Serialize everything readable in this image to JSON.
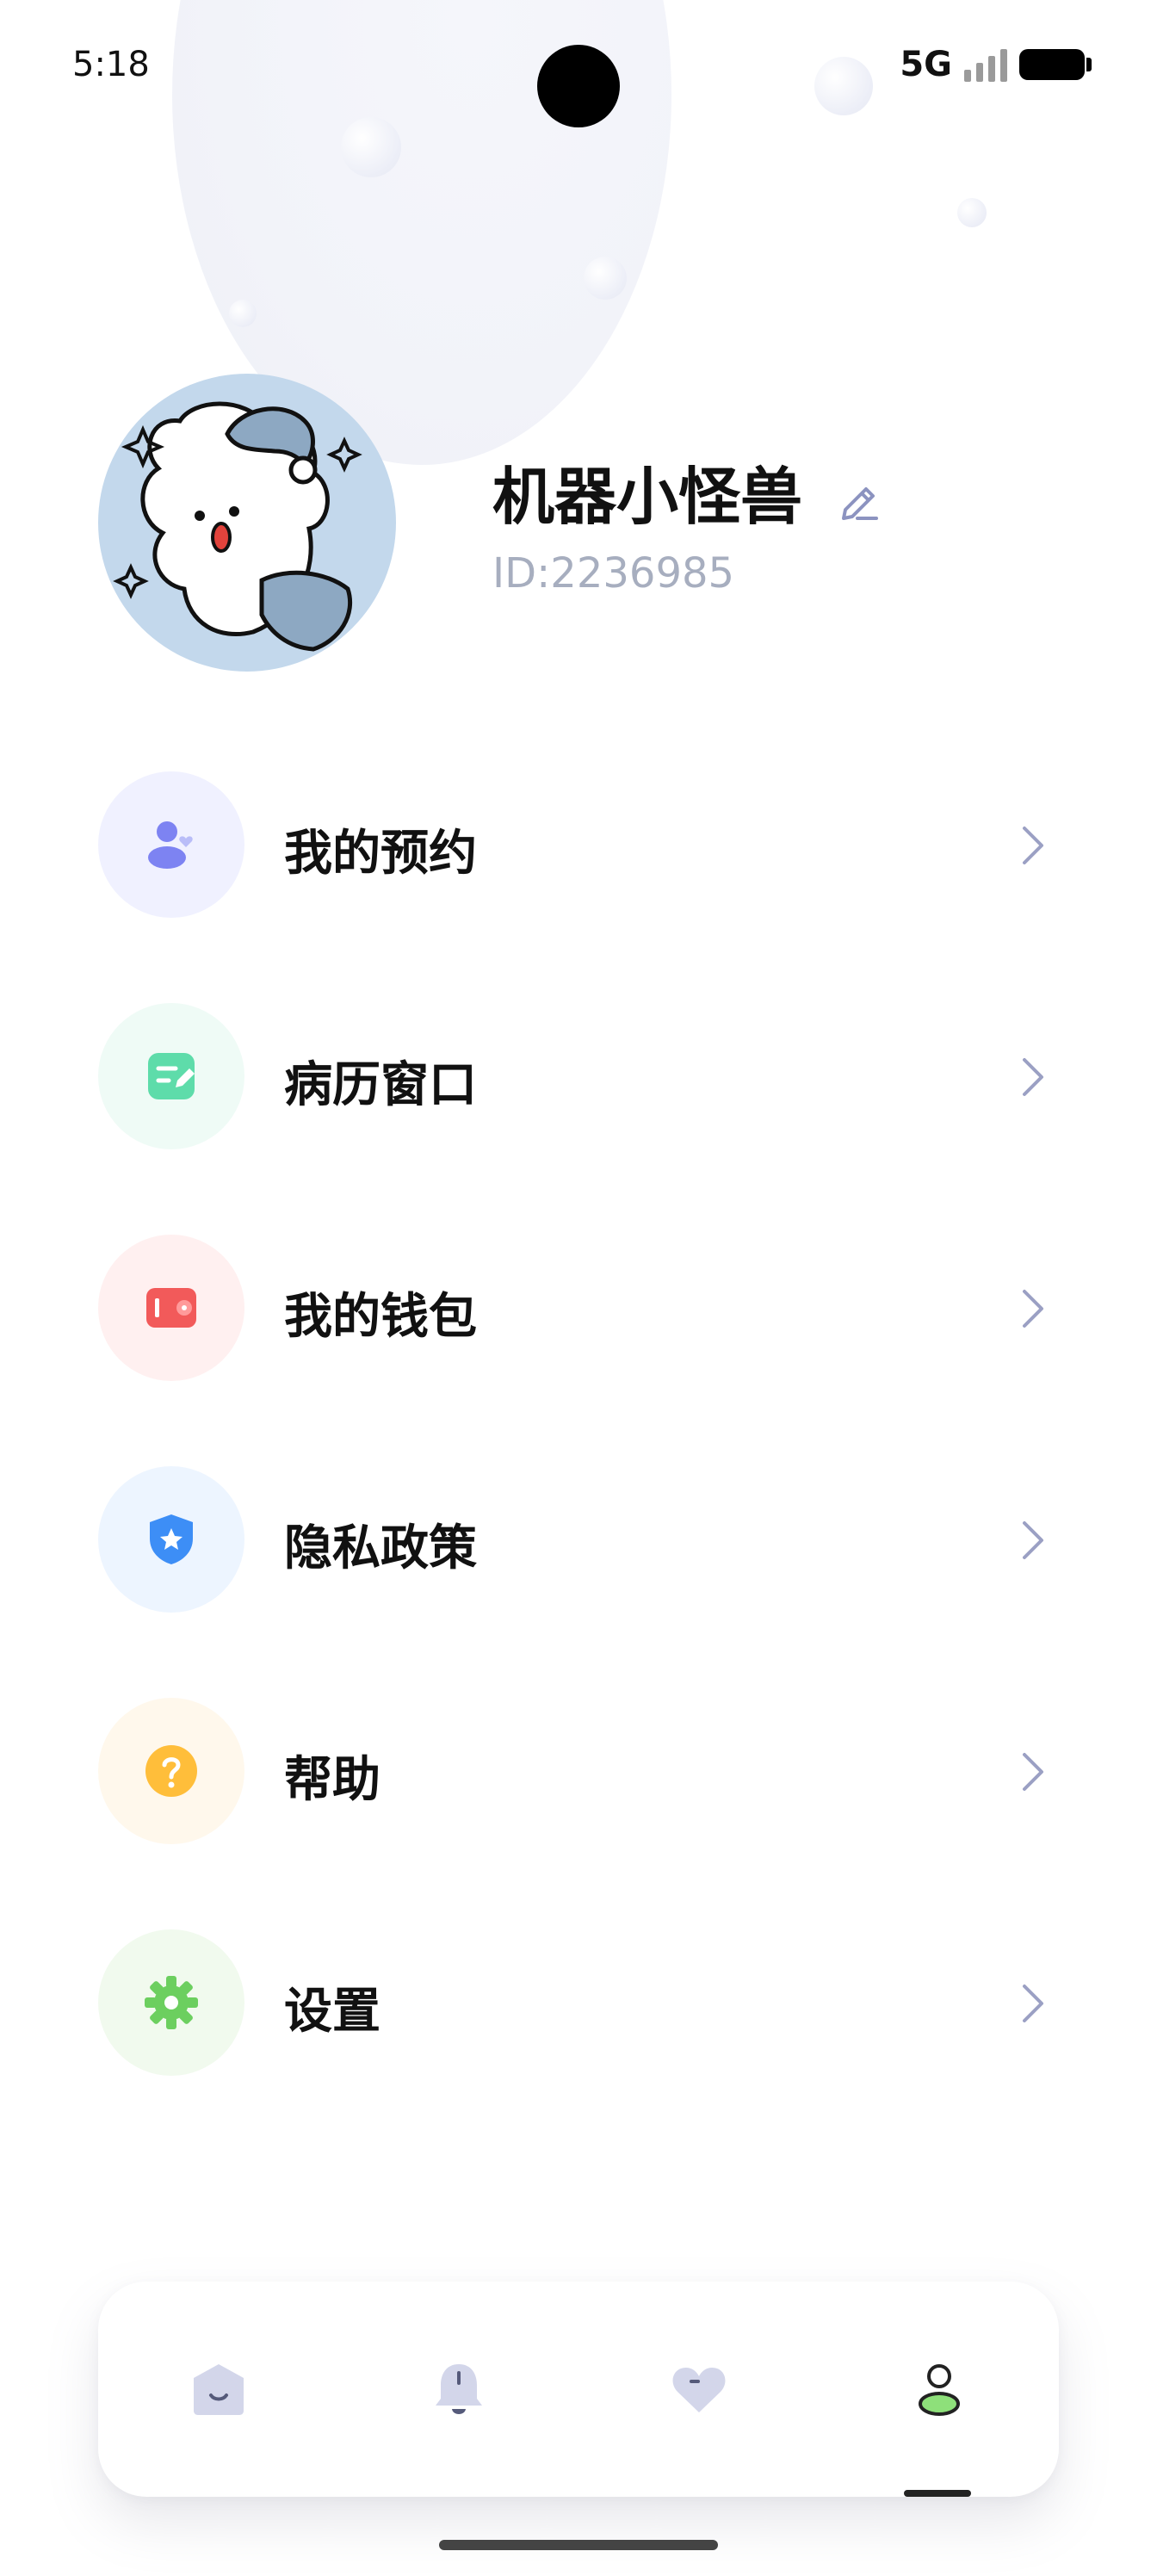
{
  "status_bar": {
    "time": "5:18",
    "network": "5G"
  },
  "profile": {
    "name": "机器小怪兽",
    "id_text": "ID:2236985"
  },
  "menu": {
    "items": [
      {
        "label": "我的预约",
        "icon": "user-appointment-icon",
        "icon_color": "#7d83f2",
        "bg_color": "#f0f1ff"
      },
      {
        "label": "病历窗口",
        "icon": "medical-record-icon",
        "icon_color": "#5edcaa",
        "bg_color": "#effbf6"
      },
      {
        "label": "我的钱包",
        "icon": "wallet-icon",
        "icon_color": "#f25a5a",
        "bg_color": "#fff0f0"
      },
      {
        "label": "隐私政策",
        "icon": "shield-icon",
        "icon_color": "#3d8ef6",
        "bg_color": "#edf5ff"
      },
      {
        "label": "帮助",
        "icon": "help-icon",
        "icon_color": "#ffbe3a",
        "bg_color": "#fff8ec"
      },
      {
        "label": "设置",
        "icon": "gear-icon",
        "icon_color": "#6ccf5f",
        "bg_color": "#f1faee"
      }
    ]
  },
  "tabbar": {
    "tabs": [
      "home-tab-icon",
      "notification-tab-icon",
      "favorites-tab-icon",
      "profile-tab-icon"
    ],
    "active": "profile"
  },
  "colors": {
    "accent_green": "#8ee07a",
    "icon_inactive": "#d3d6ea",
    "chevron": "#9ba0c4",
    "id_text": "#a7aebf"
  }
}
